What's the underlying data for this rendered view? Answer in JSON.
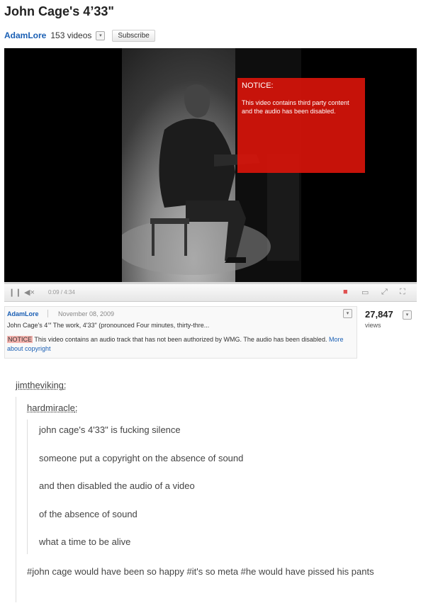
{
  "video": {
    "title": "John Cage's 4’33\"",
    "channel": "AdamLore",
    "video_count": "153 videos",
    "subscribe_label": "Subscribe",
    "overlay": {
      "heading": "NOTICE:",
      "body": "This video contains third party content and the audio has been disabled."
    },
    "time": "0:09 / 4:34",
    "info": {
      "uploader": "AdamLore",
      "date": "November 08, 2009",
      "description": "John Cage's 4’″ The work, 4'33\" (pronounced Four minutes, thirty-thre...",
      "notice_tag": "NOTICE",
      "notice_text": " This video contains an audio track that has not been authorized by WMG. The audio has been disabled. ",
      "more_link": "More about copyright"
    },
    "views": "27,847",
    "views_label": "views"
  },
  "thread": {
    "user1": "jimtheviking",
    "user2": "hardmiracle",
    "lines": [
      "john cage's 4'33\" is fucking silence",
      "someone put a copyright on the absence of sound",
      "and then disabled the audio of a video",
      "of the absence of sound",
      "what a time to be alive"
    ],
    "tags": "#john cage would have been so happy #it's so meta #he would have pissed his pants"
  },
  "colors": {
    "link": "#1a5fb4",
    "notice_red": "#dc140a"
  }
}
